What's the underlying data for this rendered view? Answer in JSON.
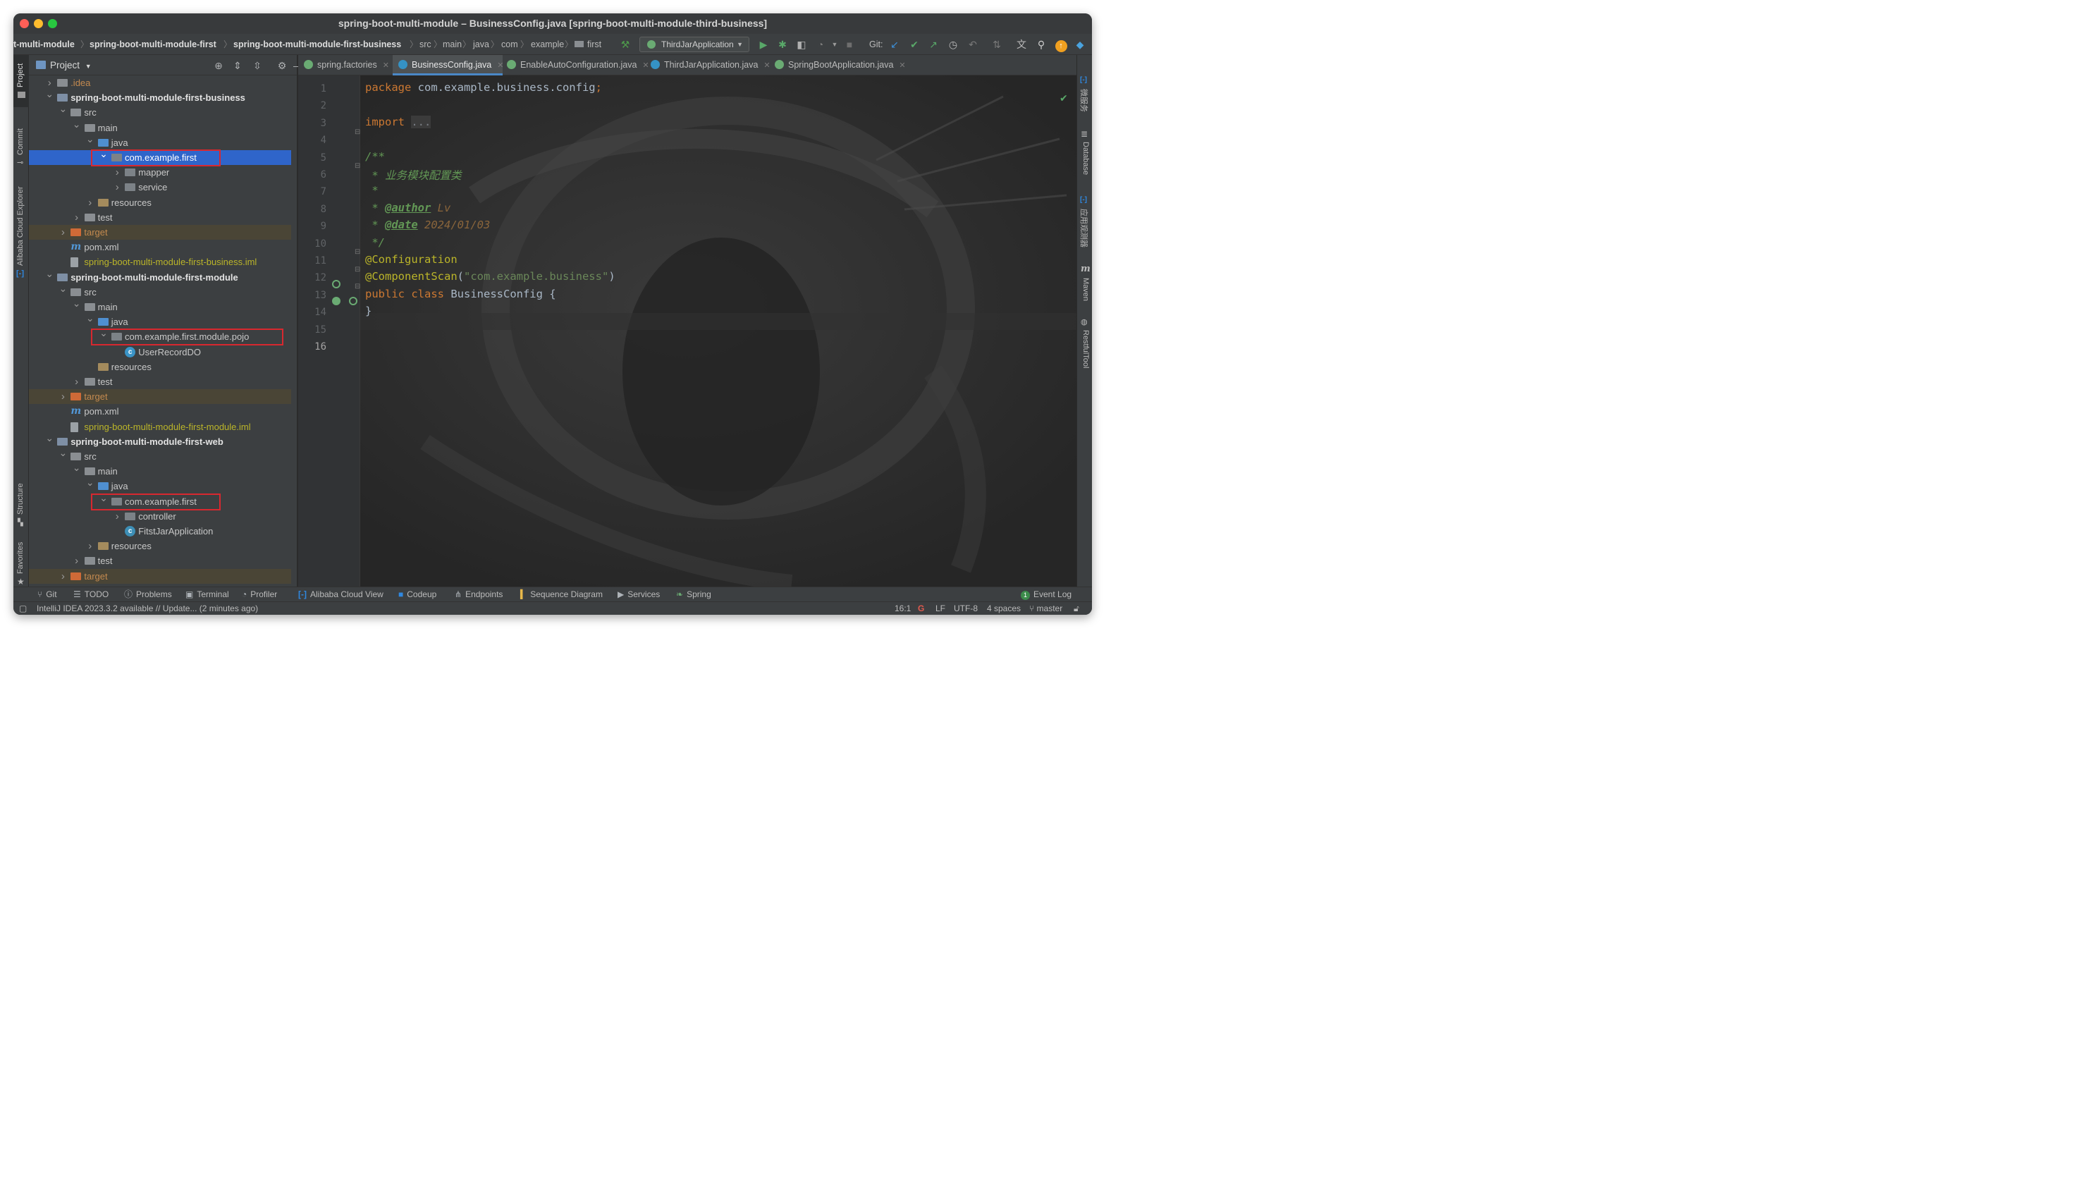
{
  "window": {
    "title": "spring-boot-multi-module – BusinessConfig.java [spring-boot-multi-module-third-business]"
  },
  "breadcrumbs": [
    "t-multi-module",
    "spring-boot-multi-module-first",
    "spring-boot-multi-module-first-business",
    "src",
    "main",
    "java",
    "com",
    "example",
    "first"
  ],
  "toolbar": {
    "run_config": "ThirdJarApplication",
    "git_label": "Git:",
    "icons": [
      "hammer-icon",
      "run-icon",
      "debug-icon",
      "coverage-icon",
      "profile-icon",
      "stop-icon",
      "git-update-icon",
      "git-commit-icon",
      "git-push-icon",
      "history-icon",
      "rollback-icon",
      "translate-icon",
      "search-icon",
      "update-icon",
      "plugin-icon"
    ]
  },
  "left_strip": [
    "Project",
    "Commit",
    "Alibaba Cloud Explorer",
    "Structure",
    "Favorites"
  ],
  "right_strip": [
    "微服务",
    "Database",
    "应用观测器",
    "Maven",
    "RestfulTool"
  ],
  "project_panel": {
    "title": "Project",
    "tree": [
      {
        "label": ".idea",
        "indent": 2,
        "arrow": "right",
        "icon": "folder",
        "style": "orange"
      },
      {
        "label": "spring-boot-multi-module-first-business",
        "indent": 2,
        "arrow": "down",
        "icon": "module",
        "style": "bold"
      },
      {
        "label": "src",
        "indent": 3,
        "arrow": "down",
        "icon": "folder",
        "style": ""
      },
      {
        "label": "main",
        "indent": 4,
        "arrow": "down",
        "icon": "folder",
        "style": ""
      },
      {
        "label": "java",
        "indent": 5,
        "arrow": "down",
        "icon": "src",
        "style": ""
      },
      {
        "label": "com.example.first",
        "indent": 6,
        "arrow": "down",
        "icon": "pkg",
        "style": "selected",
        "box": true
      },
      {
        "label": "mapper",
        "indent": 7,
        "arrow": "right",
        "icon": "pkg",
        "style": ""
      },
      {
        "label": "service",
        "indent": 7,
        "arrow": "right",
        "icon": "pkg",
        "style": ""
      },
      {
        "label": "resources",
        "indent": 5,
        "arrow": "right",
        "icon": "res",
        "style": ""
      },
      {
        "label": "test",
        "indent": 4,
        "arrow": "right",
        "icon": "folder",
        "style": ""
      },
      {
        "label": "target",
        "indent": 3,
        "arrow": "right",
        "icon": "target",
        "style": "excluded"
      },
      {
        "label": "pom.xml",
        "indent": 3,
        "arrow": "",
        "icon": "maven",
        "style": ""
      },
      {
        "label": "spring-boot-multi-module-first-business.iml",
        "indent": 3,
        "arrow": "",
        "icon": "iml",
        "style": "yellow"
      },
      {
        "label": "spring-boot-multi-module-first-module",
        "indent": 2,
        "arrow": "down",
        "icon": "module",
        "style": "bold"
      },
      {
        "label": "src",
        "indent": 3,
        "arrow": "down",
        "icon": "folder",
        "style": ""
      },
      {
        "label": "main",
        "indent": 4,
        "arrow": "down",
        "icon": "folder",
        "style": ""
      },
      {
        "label": "java",
        "indent": 5,
        "arrow": "down",
        "icon": "src",
        "style": ""
      },
      {
        "label": "com.example.first.module.pojo",
        "indent": 6,
        "arrow": "down",
        "icon": "pkg",
        "style": "",
        "box": true
      },
      {
        "label": "UserRecordDO",
        "indent": 7,
        "arrow": "",
        "icon": "class",
        "style": ""
      },
      {
        "label": "resources",
        "indent": 5,
        "arrow": "",
        "icon": "res",
        "style": ""
      },
      {
        "label": "test",
        "indent": 4,
        "arrow": "right",
        "icon": "folder",
        "style": ""
      },
      {
        "label": "target",
        "indent": 3,
        "arrow": "right",
        "icon": "target",
        "style": "excluded"
      },
      {
        "label": "pom.xml",
        "indent": 3,
        "arrow": "",
        "icon": "maven",
        "style": ""
      },
      {
        "label": "spring-boot-multi-module-first-module.iml",
        "indent": 3,
        "arrow": "",
        "icon": "iml",
        "style": "yellow"
      },
      {
        "label": "spring-boot-multi-module-first-web",
        "indent": 2,
        "arrow": "down",
        "icon": "module",
        "style": "bold"
      },
      {
        "label": "src",
        "indent": 3,
        "arrow": "down",
        "icon": "folder",
        "style": ""
      },
      {
        "label": "main",
        "indent": 4,
        "arrow": "down",
        "icon": "folder",
        "style": ""
      },
      {
        "label": "java",
        "indent": 5,
        "arrow": "down",
        "icon": "src",
        "style": ""
      },
      {
        "label": "com.example.first",
        "indent": 6,
        "arrow": "down",
        "icon": "pkg",
        "style": "",
        "box": true
      },
      {
        "label": "controller",
        "indent": 7,
        "arrow": "right",
        "icon": "pkg",
        "style": ""
      },
      {
        "label": "FitstJarApplication",
        "indent": 7,
        "arrow": "",
        "icon": "app",
        "style": ""
      },
      {
        "label": "resources",
        "indent": 5,
        "arrow": "right",
        "icon": "res",
        "style": ""
      },
      {
        "label": "test",
        "indent": 4,
        "arrow": "right",
        "icon": "folder",
        "style": ""
      },
      {
        "label": "target",
        "indent": 3,
        "arrow": "right",
        "icon": "target",
        "style": "excluded"
      }
    ]
  },
  "tabs": [
    {
      "label": "spring.factories",
      "active": false,
      "icon_color": "#6aab73"
    },
    {
      "label": "BusinessConfig.java",
      "active": true,
      "icon_color": "#3592c4"
    },
    {
      "label": "EnableAutoConfiguration.java",
      "active": false,
      "icon_color": "#6aab73"
    },
    {
      "label": "ThirdJarApplication.java",
      "active": false,
      "icon_color": "#3592c4"
    },
    {
      "label": "SpringBootApplication.java",
      "active": false,
      "icon_color": "#6aab73"
    }
  ],
  "editor": {
    "current_line": 16,
    "lines": [
      [
        [
          "kw",
          "package "
        ],
        [
          "",
          "com.example.business.config"
        ],
        [
          "kw",
          ";"
        ]
      ],
      [],
      [
        [
          "kw",
          "import "
        ],
        [
          "fold",
          "..."
        ]
      ],
      [],
      [
        [
          "doc",
          "/**"
        ]
      ],
      [
        [
          "doc",
          " * 业务模块配置类"
        ]
      ],
      [
        [
          "doc",
          " *"
        ]
      ],
      [
        [
          "doc",
          " * "
        ],
        [
          "doctag",
          "@author"
        ],
        [
          "docval",
          " Lv"
        ]
      ],
      [
        [
          "doc",
          " * "
        ],
        [
          "doctag",
          "@date"
        ],
        [
          "docval",
          " 2024/01/03"
        ]
      ],
      [
        [
          "doc",
          " */"
        ]
      ],
      [
        [
          "ann",
          "@Configuration"
        ]
      ],
      [
        [
          "ann",
          "@ComponentScan"
        ],
        [
          "",
          "("
        ],
        [
          "str",
          "\"com.example.business\""
        ],
        [
          "",
          ")"
        ]
      ],
      [
        [
          "kw",
          "public class "
        ],
        [
          "",
          "BusinessConfig {"
        ]
      ],
      [
        [
          "",
          "}"
        ]
      ],
      [],
      []
    ]
  },
  "tool_windows": [
    "Git",
    "TODO",
    "Problems",
    "Terminal",
    "Profiler",
    "Alibaba Cloud View",
    "Codeup",
    "Endpoints",
    "Sequence Diagram",
    "Services",
    "Spring"
  ],
  "event_log": {
    "count": "1",
    "label": "Event Log"
  },
  "status": {
    "message": "IntelliJ IDEA 2023.3.2 available // Update... (2 minutes ago)",
    "position": "16:1",
    "line_sep": "LF",
    "encoding": "UTF-8",
    "indent": "4 spaces",
    "branch": "master"
  },
  "colors": {
    "selection": "#2f65ca",
    "accent_tab": "#4a88c7",
    "highlight_box": "#d8282f"
  }
}
